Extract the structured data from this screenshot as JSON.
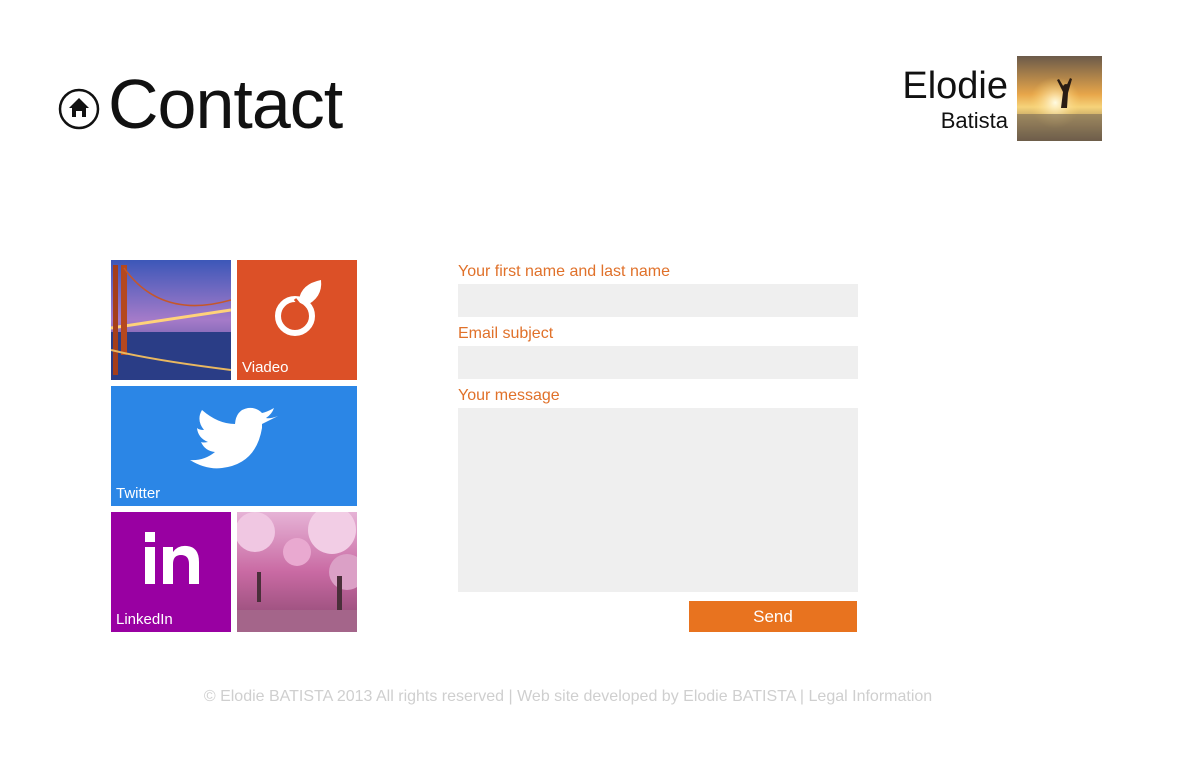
{
  "header": {
    "title": "Contact",
    "home_icon": "home-icon"
  },
  "profile": {
    "first_name": "Elodie",
    "last_name": "Batista"
  },
  "tiles": {
    "viadeo": {
      "label": "Viadeo",
      "color": "#dc5027",
      "icon": "viadeo-icon"
    },
    "twitter": {
      "label": "Twitter",
      "color": "#2b86e6",
      "icon": "twitter-bird-icon"
    },
    "linkedin": {
      "label": "LinkedIn",
      "color": "#9900a2",
      "icon": "linkedin-icon"
    }
  },
  "form": {
    "name_label": "Your first name and last name",
    "subject_label": "Email subject",
    "message_label": "Your message",
    "name_value": "",
    "subject_value": "",
    "message_value": "",
    "send_label": "Send"
  },
  "footer": {
    "copyright": "© Elodie BATISTA 2013 All rights reserved",
    "sep1": " | ",
    "developed": "Web site developed by Elodie BATISTA",
    "sep2": " | ",
    "legal": "Legal Information"
  },
  "colors": {
    "accent": "#e8731f",
    "label": "#e0712a"
  }
}
